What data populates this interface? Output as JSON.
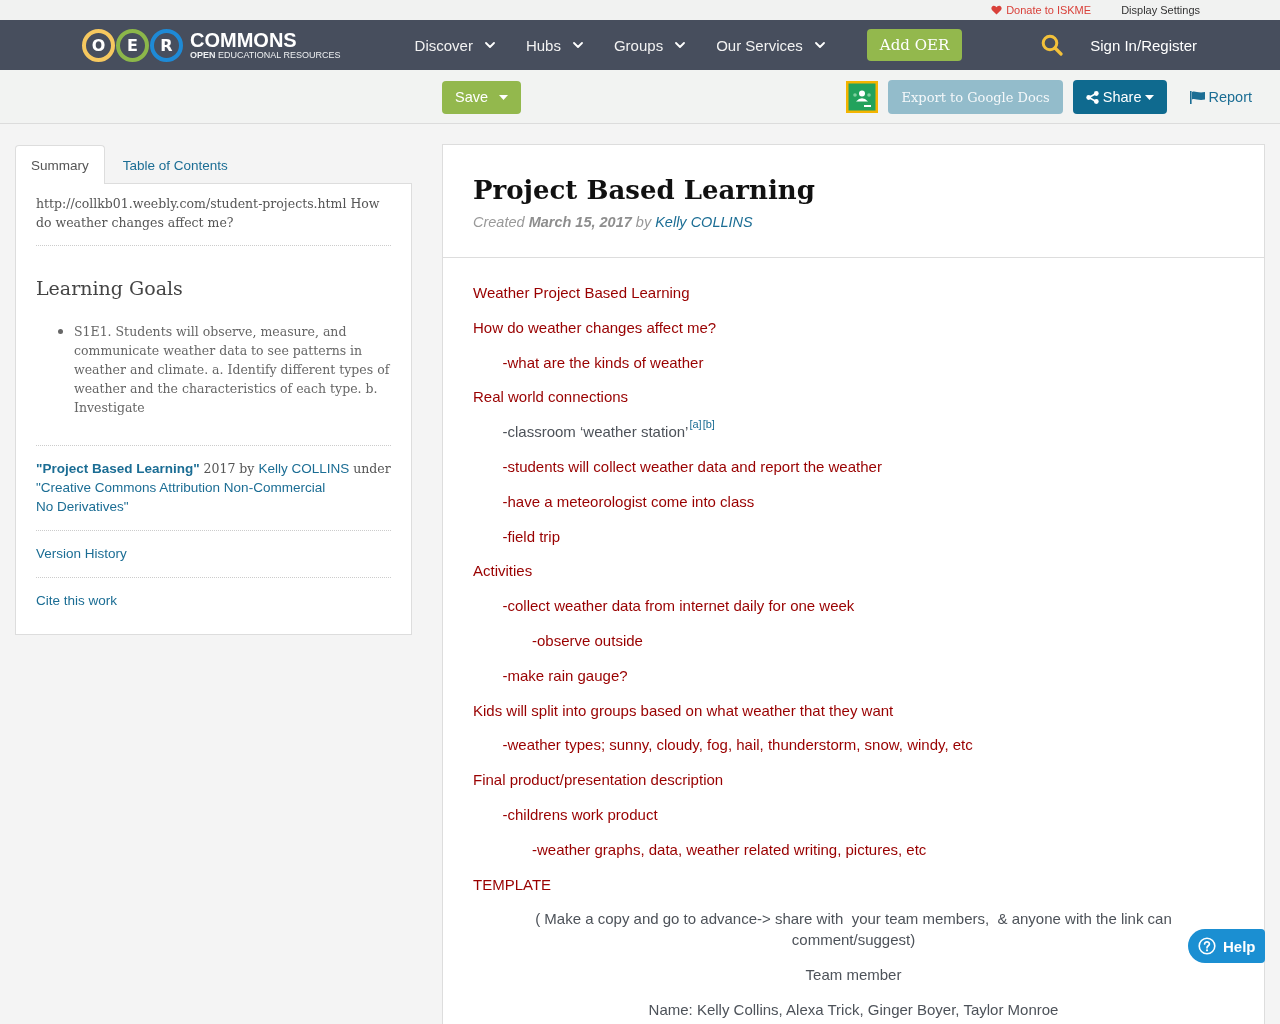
{
  "utility_links": {
    "donate": "Donate to ISKME",
    "display_settings": "Display Settings"
  },
  "logo": {
    "rings": [
      {
        "letter": "O",
        "color": "#f6c85f"
      },
      {
        "letter": "E",
        "color": "#8cb74a"
      },
      {
        "letter": "R",
        "color": "#1e8ad6"
      }
    ],
    "name": "COMMONS",
    "tagline": "**OPEN** EDUCATIONAL RESOURCES"
  },
  "nav": {
    "items": [
      {
        "label": "Discover",
        "has_menu": true
      },
      {
        "label": "Hubs",
        "has_menu": true
      },
      {
        "label": "Groups",
        "has_menu": true
      },
      {
        "label": "Our Services",
        "has_menu": true
      }
    ],
    "add_button": "Add OER",
    "sign_in": "Sign In/Register"
  },
  "toolbar": {
    "save": "Save",
    "export": {
      "label": "Export to Google Docs",
      "disabled": true
    },
    "share": "Share",
    "report": "Report"
  },
  "sidebar": {
    "tabs": [
      {
        "label": "Summary",
        "selected": true
      },
      {
        "label": "Table of Contents",
        "selected": false
      }
    ],
    "summary": "http://collkb01.weebly.com/student-projects.html How do weather changes affect me?",
    "goals_heading": "Learning Goals",
    "goals": [
      "S1E1. Students will observe, measure, and communicate weather data to see patterns in weather and climate. a. Identify different types of weather and the characteristics of each type. b. Investigate"
    ],
    "attribution": {
      "title": "\"Project Based Learning\"",
      "year_by": "2017 by",
      "author": "Kelly COLLINS",
      "under": "under",
      "license": "\"Creative Commons Attribution Non-Commercial No Derivatives\""
    },
    "links": [
      "Version History",
      "Cite this work"
    ]
  },
  "document": {
    "title": "Project Based Learning",
    "byline": "Created **March 15, 2017** by",
    "author": "Kelly COLLINS",
    "lines": [
      {
        "text": "Weather Project Based Learning",
        "color": "#990000"
      },
      {
        "text": "How do weather changes affect me?",
        "color": "#990000",
        "children": [
          {
            "text": "-what are the kinds of weather",
            "color": "#990000"
          }
        ]
      },
      {
        "text": "Real world connections",
        "color": "#990000",
        "children": [
          {
            "text": "-classroom ‘weather station’",
            "color": "#4d5259",
            "refs": [
              "[a]",
              "[b]"
            ]
          },
          {
            "text": "-students will collect weather data and report the weather",
            "color": "#990000"
          },
          {
            "text": "-have a meteorologist come into class",
            "color": "#990000"
          },
          {
            "text": "-field trip",
            "color": "#990000"
          }
        ]
      },
      {
        "text": "Activities",
        "color": "#990000",
        "children": [
          {
            "text": "-collect weather data from internet daily for one week",
            "color": "#990000",
            "children": [
              {
                "text": "-observe outside",
                "color": "#990000"
              }
            ]
          },
          {
            "text": "-make rain gauge?",
            "color": "#990000"
          }
        ]
      },
      {
        "text": "Kids will split into groups based on what weather that they want",
        "color": "#990000",
        "children": [
          {
            "text": "-weather types; sunny, cloudy, fog, hail, thunderstorm, snow, windy, etc",
            "color": "#990000"
          }
        ]
      },
      {
        "text": "Final product/presentation description",
        "color": "#990000",
        "children": [
          {
            "text": "-childrens work product",
            "color": "#990000",
            "children": [
              {
                "text": "-weather graphs, data, weather related writing, pictures, etc",
                "color": "#990000"
              }
            ]
          }
        ]
      },
      {
        "text": "TEMPLATE",
        "color": "#990000"
      }
    ],
    "template_notes": [
      "( Make a copy and go to advance-> share with  your team members,  & anyone with the link can comment/suggest)",
      "Team member",
      "Name: Kelly Collins, Alexa Trick, Ginger Boyer, Taylor Monroe"
    ]
  },
  "help": {
    "label": "Help"
  }
}
